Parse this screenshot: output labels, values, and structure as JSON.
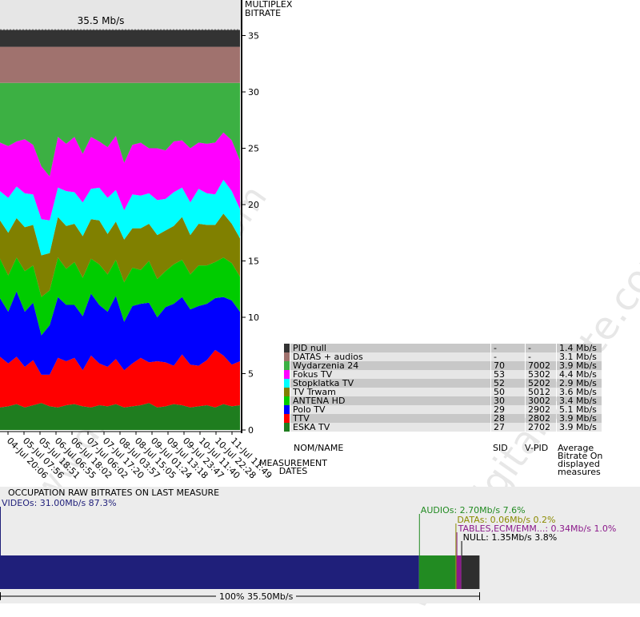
{
  "chart_data": {
    "type": "area",
    "stacked": true,
    "title": "35.5 Mb/s",
    "ylabel": "MULTIPLEX BITRATE",
    "xlabel": "MEASUREMENT DATES",
    "ylim": [
      0,
      36
    ],
    "yticks": [
      0,
      5,
      10,
      15,
      20,
      25,
      30,
      35
    ],
    "x_ticks": [
      "04-Jul 20:06",
      "05-Jul 07:56",
      "05-Jul 18:51",
      "06-Jul 06:55",
      "06-Jul 18:02",
      "07-Jul 06:02",
      "07-Jul 17:20",
      "08-Jul 03:57",
      "08-Jul 15:05",
      "09-Jul 01:24",
      "09-Jul 13:18",
      "09-Jul 23:47",
      "10-Jul 11:40",
      "10-Jul 22:28",
      "11-Jul 11:49"
    ],
    "grid": false,
    "series": [
      {
        "name": "ESKA TV",
        "sid": "27",
        "vpid": "2702",
        "avg": "3.9 Mb/s",
        "color": "#1f7d1f",
        "values": [
          2.0,
          2.1,
          2.3,
          2.0,
          2.2,
          2.4,
          2.1,
          2.0,
          2.2,
          2.3,
          2.1,
          2.0,
          2.2,
          2.1,
          2.3,
          2.0,
          2.1,
          2.2,
          2.4,
          2.0,
          2.1,
          2.3,
          2.2,
          2.0,
          2.1,
          2.2,
          2.0,
          2.3,
          2.1,
          2.2
        ]
      },
      {
        "name": "TTV",
        "sid": "28",
        "vpid": "2802",
        "avg": "3.9 Mb/s",
        "color": "#ff0000",
        "values": [
          4.5,
          3.8,
          4.2,
          3.6,
          4.0,
          2.5,
          2.8,
          4.4,
          3.9,
          4.1,
          3.2,
          4.6,
          3.7,
          3.5,
          4.0,
          3.3,
          3.8,
          4.2,
          3.6,
          4.1,
          3.9,
          3.4,
          4.5,
          3.8,
          3.6,
          4.0,
          5.1,
          4.3,
          3.7,
          3.9
        ]
      },
      {
        "name": "Polo TV",
        "sid": "29",
        "vpid": "2902",
        "avg": "5.1 Mb/s",
        "color": "#0000ff",
        "values": [
          5.2,
          4.6,
          5.8,
          4.9,
          5.1,
          3.5,
          4.4,
          5.4,
          5.0,
          4.7,
          4.8,
          5.5,
          5.2,
          4.9,
          5.6,
          4.3,
          5.1,
          4.8,
          5.3,
          3.9,
          4.9,
          5.5,
          5.1,
          4.9,
          5.3,
          5.0,
          4.6,
          5.2,
          5.7,
          4.4
        ]
      },
      {
        "name": "ANTENA HD",
        "sid": "30",
        "vpid": "3002",
        "avg": "3.4 Mb/s",
        "color": "#00cc00",
        "values": [
          3.5,
          3.2,
          3.0,
          3.6,
          3.3,
          3.4,
          3.1,
          3.5,
          3.2,
          3.8,
          3.4,
          3.1,
          3.6,
          3.3,
          3.2,
          3.5,
          3.4,
          3.0,
          3.7,
          3.4,
          3.2,
          3.5,
          3.3,
          3.1,
          3.6,
          3.4,
          3.2,
          3.5,
          3.3,
          3.1
        ]
      },
      {
        "name": "TV Trwam",
        "sid": "50",
        "vpid": "5012",
        "avg": "3.6 Mb/s",
        "color": "#808000",
        "values": [
          3.4,
          3.8,
          3.5,
          3.9,
          3.6,
          3.7,
          3.3,
          3.6,
          3.8,
          3.4,
          3.7,
          3.5,
          3.9,
          3.6,
          3.4,
          3.8,
          3.5,
          3.7,
          3.3,
          3.9,
          3.6,
          3.4,
          3.8,
          3.5,
          3.7,
          3.6,
          3.3,
          3.9,
          3.5,
          3.4
        ]
      },
      {
        "name": "Stopklatka TV",
        "sid": "52",
        "vpid": "5202",
        "avg": "2.9 Mb/s",
        "color": "#00ffff",
        "values": [
          2.6,
          3.1,
          2.8,
          3.0,
          2.7,
          3.2,
          2.9,
          2.6,
          3.1,
          2.8,
          3.0,
          2.7,
          2.9,
          3.2,
          2.8,
          2.6,
          3.0,
          2.9,
          2.7,
          3.1,
          2.8,
          3.0,
          2.6,
          2.9,
          3.1,
          2.8,
          2.7,
          3.0,
          2.9,
          2.6
        ]
      },
      {
        "name": "Fokus TV",
        "sid": "53",
        "vpid": "5302",
        "avg": "4.4 Mb/s",
        "color": "#ff00ff",
        "values": [
          4.3,
          4.6,
          4.0,
          4.8,
          4.4,
          4.7,
          3.9,
          4.5,
          4.2,
          4.9,
          4.3,
          4.6,
          4.1,
          4.5,
          4.8,
          4.2,
          4.4,
          4.7,
          4.0,
          4.6,
          4.3,
          4.5,
          4.2,
          4.8,
          4.1,
          4.4,
          4.6,
          4.2,
          4.5,
          4.3
        ]
      },
      {
        "name": "Wydarzenia 24",
        "sid": "70",
        "vpid": "7002",
        "avg": "3.9 Mb/s",
        "color": "#3cb043",
        "values": [
          null
        ]
      },
      {
        "name": "DATAS + audios",
        "sid": "-",
        "vpid": "-",
        "avg": "3.1 Mb/s",
        "color": "#a0726e",
        "values": [
          null
        ]
      },
      {
        "name": "PID null",
        "sid": "-",
        "vpid": "-",
        "avg": "1.4 Mb/s",
        "color": "#333333",
        "values": [
          null
        ]
      }
    ],
    "fixed_bands": {
      "wydarzenia_top": 30.8,
      "datas_top": 34.0,
      "total": 35.5
    }
  },
  "legend": {
    "col_name": "NOM/NAME",
    "col_sid": "SID",
    "col_vpid": "V-PID",
    "col_avg": "Average Bitrate On displayed measures",
    "rows": [
      {
        "name": "PID null",
        "sid": "-",
        "vpid": "-",
        "avg": "1.4 Mb/s",
        "color": "#333333"
      },
      {
        "name": "DATAS + audios",
        "sid": "-",
        "vpid": "-",
        "avg": "3.1 Mb/s",
        "color": "#a0726e"
      },
      {
        "name": "Wydarzenia 24",
        "sid": "70",
        "vpid": "7002",
        "avg": "3.9 Mb/s",
        "color": "#3cb043"
      },
      {
        "name": "Fokus TV",
        "sid": "53",
        "vpid": "5302",
        "avg": "4.4 Mb/s",
        "color": "#ff00ff"
      },
      {
        "name": "Stopklatka TV",
        "sid": "52",
        "vpid": "5202",
        "avg": "2.9 Mb/s",
        "color": "#00ffff"
      },
      {
        "name": "TV Trwam",
        "sid": "50",
        "vpid": "5012",
        "avg": "3.6 Mb/s",
        "color": "#808000"
      },
      {
        "name": "ANTENA HD",
        "sid": "30",
        "vpid": "3002",
        "avg": "3.4 Mb/s",
        "color": "#00cc00"
      },
      {
        "name": "Polo TV",
        "sid": "29",
        "vpid": "2902",
        "avg": "5.1 Mb/s",
        "color": "#0000ff"
      },
      {
        "name": "TTV",
        "sid": "28",
        "vpid": "2802",
        "avg": "3.9 Mb/s",
        "color": "#ff0000"
      },
      {
        "name": "ESKA TV",
        "sid": "27",
        "vpid": "2702",
        "avg": "3.9 Mb/s",
        "color": "#1f7d1f"
      }
    ]
  },
  "occupation": {
    "title": "OCCUPATION RAW BITRATES ON LAST MEASURE",
    "total_label": "100%  35.50Mb/s",
    "segments": [
      {
        "key": "video",
        "label": "VIDEOs: 31.00Mb/s  87.3%",
        "fraction": 0.873,
        "color": "#1f1f7a",
        "text_color": "#1f1f7a"
      },
      {
        "key": "audio",
        "label": "AUDIOs: 2.70Mb/s  7.6%",
        "fraction": 0.076,
        "color": "#228b22",
        "text_color": "#228b22"
      },
      {
        "key": "data",
        "label": "DATAs: 0.06Mb/s  0.2%",
        "fraction": 0.002,
        "color": "#8b8b00",
        "text_color": "#8b8b00"
      },
      {
        "key": "tables",
        "label": "TABLES,ECM/EMM...: 0.34Mb/s  1.0%",
        "fraction": 0.01,
        "color": "#8b1a8b",
        "text_color": "#8b1a8b"
      },
      {
        "key": "null",
        "label": "NULL: 1.35Mb/s  3.8%",
        "fraction": 0.038,
        "color": "#2e2e2e",
        "text_color": "#000000"
      }
    ]
  },
  "watermark": "www.digitalbitrate.com"
}
